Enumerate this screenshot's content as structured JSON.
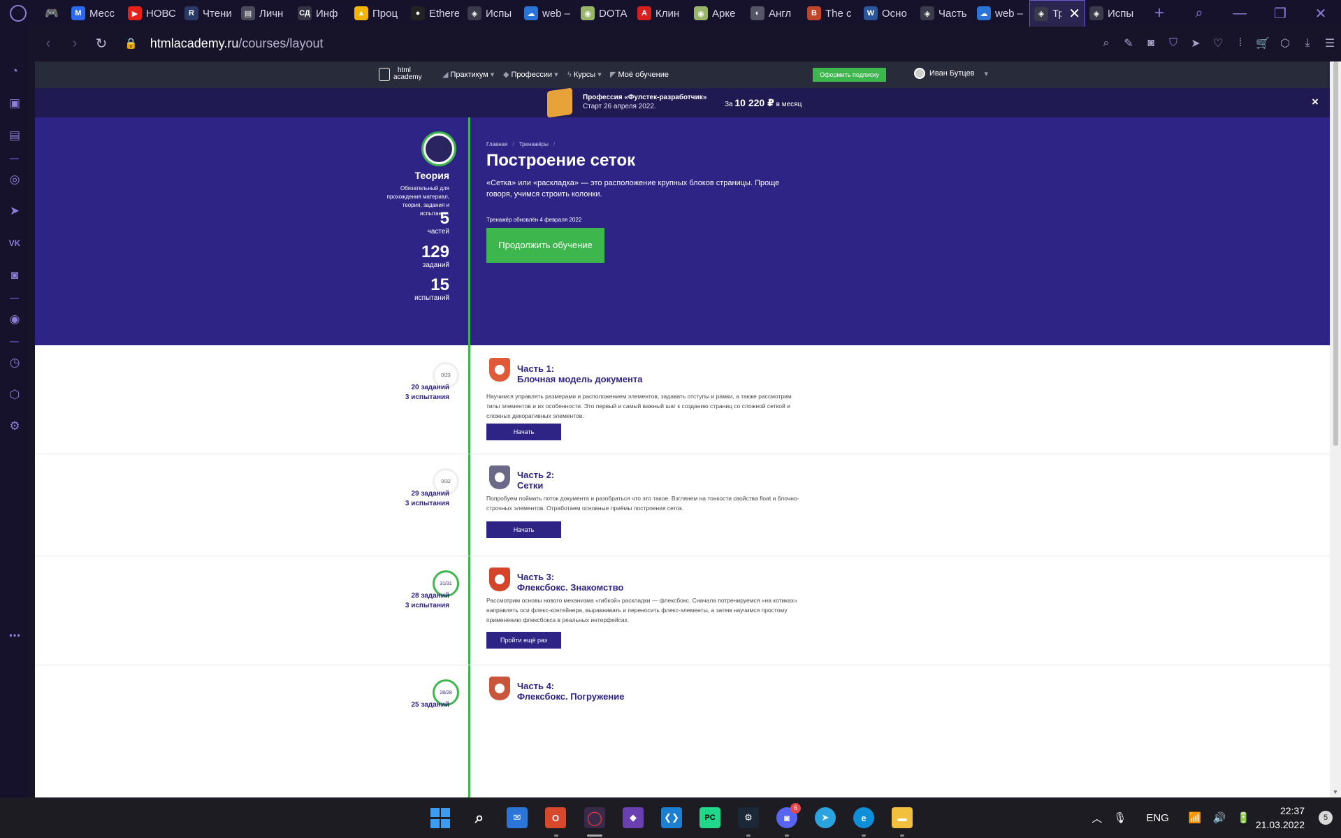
{
  "browser": {
    "tabs": [
      {
        "label": "Месс",
        "icon": "messenger-icon",
        "color": "#2b6af0",
        "glyph": "M"
      },
      {
        "label": "НОВС",
        "icon": "youtube-icon",
        "color": "#e62117",
        "glyph": "▶"
      },
      {
        "label": "Чтени",
        "icon": "ranobe-icon",
        "color": "#2a3a66",
        "glyph": "R"
      },
      {
        "label": "Личн",
        "icon": "profile-icon",
        "color": "#4a4a5a",
        "glyph": "▤"
      },
      {
        "label": "Инф",
        "icon": "sd-icon",
        "color": "#333344",
        "glyph": "СД"
      },
      {
        "label": "Проц",
        "icon": "google-drive-icon",
        "color": "#f4b400",
        "glyph": "▲"
      },
      {
        "label": "Ethere",
        "icon": "github-icon",
        "color": "#222222",
        "glyph": "●"
      },
      {
        "label": "Испы",
        "icon": "htmlacademy-icon",
        "color": "#3a3a4a",
        "glyph": "◈"
      },
      {
        "label": "web –",
        "icon": "onedrive-icon",
        "color": "#2a74d8",
        "glyph": "☁"
      },
      {
        "label": "DOTA",
        "icon": "dota-icon",
        "color": "#98b56a",
        "glyph": "◉"
      },
      {
        "label": "Клин",
        "icon": "letter-a-icon",
        "color": "#d62020",
        "glyph": "A"
      },
      {
        "label": "Арке",
        "icon": "arcane-icon",
        "color": "#98b56a",
        "glyph": "◉"
      },
      {
        "label": "Англ",
        "icon": "globe-icon",
        "color": "#555566",
        "glyph": "◐"
      },
      {
        "label": "The c",
        "icon": "book-icon",
        "color": "#c0462a",
        "glyph": "B"
      },
      {
        "label": "Осно",
        "icon": "word-icon",
        "color": "#2b579a",
        "glyph": "W"
      },
      {
        "label": "Часть",
        "icon": "htmlacademy-icon",
        "color": "#3a3a4a",
        "glyph": "◈"
      },
      {
        "label": "web –",
        "icon": "onedrive-icon",
        "color": "#2a74d8",
        "glyph": "☁"
      }
    ],
    "active_tab": {
      "label": "Тр",
      "icon": "htmlacademy-icon"
    },
    "after_tab": {
      "label": "Испы",
      "icon": "htmlacademy-icon",
      "color": "#3a3a4a",
      "glyph": "◈"
    },
    "url_host": "htmlacademy.ru",
    "url_path": "/courses/layout"
  },
  "site": {
    "logo_line1": "html",
    "logo_line2": "academy",
    "nav": {
      "practicum": "Практикум",
      "professions": "Профессии",
      "courses": "Курсы",
      "my_learning": "Моё обучение"
    },
    "subscribe": "Оформить подписку",
    "user_name": "Иван Бутцев"
  },
  "promo": {
    "title": "Профессия «Фулстек-разработчик»",
    "date": "Старт 26 апреля 2022.",
    "price_prefix": "За",
    "price": "10 220 ₽",
    "price_suffix": "в месяц",
    "close": "×"
  },
  "hero": {
    "sidebar_title": "Теория",
    "sidebar_desc": "Обязательный для прохождения материал, теория, задания и испытания.",
    "stats": [
      {
        "number": "5",
        "label": "частей"
      },
      {
        "number": "129",
        "label": "заданий"
      },
      {
        "number": "15",
        "label": "испытаний"
      }
    ],
    "breadcrumb_home": "Главная",
    "breadcrumb_trainers": "Тренажёры",
    "title": "Построение сеток",
    "description": "«Сетка» или «раскладка» — это расположение крупных блоков страницы. Проще говоря, учимся строить колонки.",
    "updated": "Тренажёр обновлён 4 февраля 2022",
    "continue": "Продолжить обучение"
  },
  "parts": [
    {
      "progress": "0/23",
      "done": false,
      "tasks": "20 заданий",
      "tests": "3 испытания",
      "label": "Часть 1:",
      "name": "Блочная модель документа",
      "desc": "Научимся управлять размерами и расположением элементов, задавать отступы и рамки, а также рассмотрим типы элементов и их особенности. Это первый и самый важный шаг к созданию страниц со сложной сеткой и сложных декоративных элементов.",
      "button": "Начать",
      "color": "#e05a3a"
    },
    {
      "progress": "0/32",
      "done": false,
      "tasks": "29 заданий",
      "tests": "3 испытания",
      "label": "Часть 2:",
      "name": "Сетки",
      "desc": "Попробуем поймать поток документа и разобраться что это такое. Взглянем на тонкости свойства float и блочно-строчных элементов. Отработаем основные приёмы построения сеток.",
      "button": "Начать",
      "color": "#6a6a88"
    },
    {
      "progress": "31/31",
      "done": true,
      "tasks": "28 заданий",
      "tests": "3 испытания",
      "label": "Часть 3:",
      "name": "Флексбокс. Знакомство",
      "desc": "Рассмотрим основы нового механизма «гибкой» раскладки — флексбокс. Сначала потренируемся «на котиках» направлять оси флекс-контейнера, выравнивать и переносить флекс-элементы, а затем научимся простому применению флексбокса в реальных интерфейсах.",
      "button": "Пройти ещё раз",
      "color": "#d2452a"
    },
    {
      "progress": "28/28",
      "done": true,
      "tasks": "25 заданий",
      "tests": "",
      "label": "Часть 4:",
      "name": "Флексбокс. Погружение",
      "desc": "",
      "button": "",
      "color": "#c9563a"
    }
  ],
  "taskbar": {
    "discord_badge": "6",
    "language": "ENG",
    "time": "22:37",
    "date": "21.03.2022",
    "notifications": "5"
  }
}
